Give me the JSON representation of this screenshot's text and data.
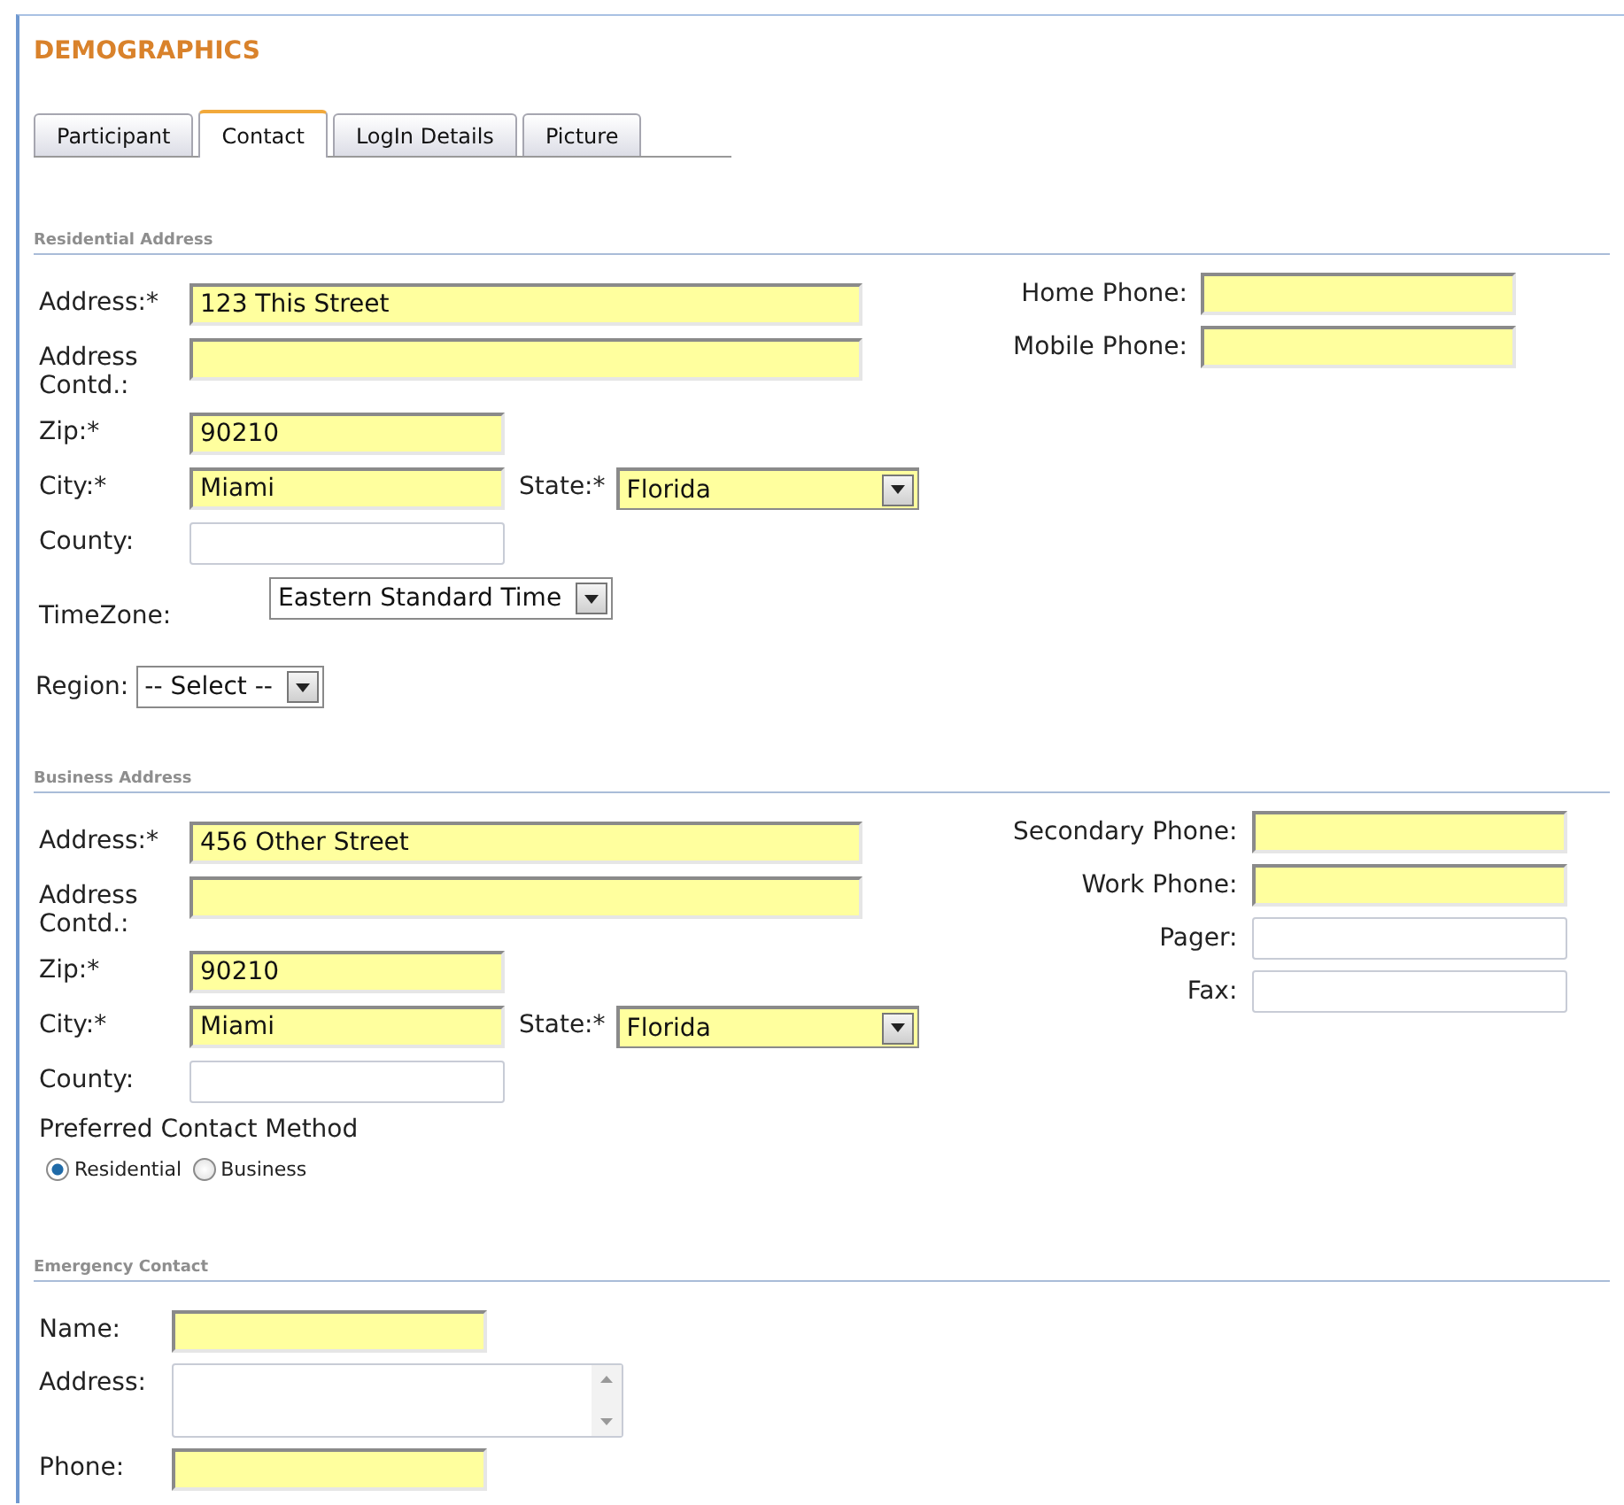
{
  "title": "DEMOGRAPHICS",
  "tabs": [
    {
      "label": "Participant",
      "selected": false
    },
    {
      "label": "Contact",
      "selected": true
    },
    {
      "label": "LogIn Details",
      "selected": false
    },
    {
      "label": "Picture",
      "selected": false
    }
  ],
  "sections": [
    {
      "heading": "Residential Address",
      "rows": [
        {
          "kind": "standard",
          "fields": [
            {
              "label": "Address:*",
              "kind": "long_text",
              "value": "123 This Street",
              "required": true
            }
          ]
        },
        {
          "kind": "standard",
          "fields": [
            {
              "label": "Address Contd.:",
              "kind": "long_text",
              "required": true
            }
          ]
        },
        {
          "kind": "standard",
          "fields": [
            {
              "label": "Zip:*",
              "kind": "text",
              "value": "90210",
              "required": true
            }
          ]
        },
        {
          "kind": "standard",
          "fields": [
            {
              "label": "City:*",
              "kind": "text",
              "value": "Miami",
              "required": true
            },
            {
              "label": "State:*",
              "kind": "select",
              "value": "Florida",
              "required": true
            }
          ]
        },
        {
          "kind": "standard",
          "fields": [
            {
              "label": "County:",
              "kind": "text",
              "required": false
            }
          ]
        },
        {
          "kind": "offset",
          "fields": [
            {
              "label": "TimeZone:",
              "kind": "select",
              "value": "Eastern Standard Time",
              "required": false
            }
          ]
        },
        {
          "kind": "inline",
          "fields": [
            {
              "label": "Region:",
              "kind": "select",
              "value": "-- Select --",
              "required": false
            }
          ]
        }
      ],
      "phones": [
        {
          "label": "Home Phone:",
          "kind": "text",
          "required": true
        },
        {
          "label": "Mobile Phone:",
          "kind": "text",
          "required": true
        }
      ]
    },
    {
      "heading": "Business Address",
      "rows": [
        {
          "kind": "standard",
          "fields": [
            {
              "label": "Address:*",
              "kind": "long_text",
              "value": "456 Other Street",
              "required": true
            }
          ]
        },
        {
          "kind": "standard",
          "fields": [
            {
              "label": "Address Contd.:",
              "kind": "long_text",
              "required": true
            }
          ]
        },
        {
          "kind": "standard",
          "fields": [
            {
              "label": "Zip:*",
              "kind": "text",
              "value": "90210",
              "required": true
            }
          ]
        },
        {
          "kind": "standard",
          "fields": [
            {
              "label": "City:*",
              "kind": "text",
              "value": "Miami",
              "required": true
            },
            {
              "label": "State:*",
              "kind": "select",
              "value": "Florida",
              "required": true
            }
          ]
        },
        {
          "kind": "standard",
          "fields": [
            {
              "label": "County:",
              "kind": "text",
              "required": false
            }
          ]
        }
      ],
      "phones": [
        {
          "label": "Secondary Phone:",
          "kind": "text",
          "required": true
        },
        {
          "label": "Work Phone:",
          "kind": "text",
          "required": true
        },
        {
          "label": "Pager:",
          "kind": "text",
          "required": false
        },
        {
          "label": "Fax:",
          "kind": "text",
          "required": false
        }
      ],
      "contact_method": {
        "label": "Preferred Contact Method",
        "options": [
          {
            "label": "Residential",
            "selected": true
          },
          {
            "label": "Business",
            "selected": false
          }
        ]
      }
    },
    {
      "heading": "Emergency Contact",
      "rows": [
        {
          "kind": "compact",
          "fields": [
            {
              "label": "Name:",
              "kind": "text",
              "required": true
            }
          ]
        },
        {
          "kind": "compact",
          "fields": [
            {
              "label": "Address:",
              "kind": "textarea",
              "required": false
            }
          ]
        },
        {
          "kind": "compact",
          "fields": [
            {
              "label": "Phone:",
              "kind": "text",
              "required": true
            }
          ]
        }
      ]
    }
  ]
}
